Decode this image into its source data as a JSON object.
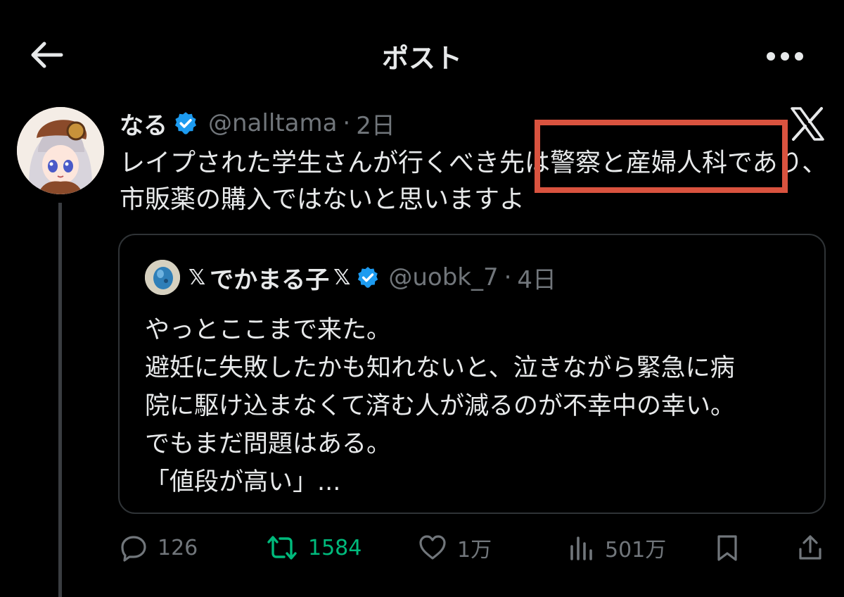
{
  "header": {
    "title": "ポスト",
    "back_icon": "arrow-left-icon",
    "more_icon": "more-horizontal-icon"
  },
  "post": {
    "display_name": "なる",
    "handle": "@nalltama",
    "separator": "·",
    "time": "2日",
    "text": "レイプされた学生さんが行くべき先は警察と産婦人科であり、市販薬の購入ではないと思いますよ",
    "verified_color": "#1d9bf0",
    "highlight_color": "#d9533f"
  },
  "quote": {
    "name_prefix": "𝕏",
    "display_name": "でかまる子",
    "name_suffix": "𝕏",
    "handle": "@uobk_7",
    "separator": "·",
    "time": "4日",
    "lines": [
      "やっとここまで来た。",
      "避妊に失敗したかも知れないと、泣きながら緊急に病",
      "院に駆け込まなくて済む人が減るのが不幸中の幸い。",
      "でもまだ問題はある。",
      "「値段が高い」..."
    ]
  },
  "actions": {
    "replies": "126",
    "retweets": "1584",
    "likes": "1万",
    "views": "501万",
    "retweet_color": "#00ba7c"
  }
}
